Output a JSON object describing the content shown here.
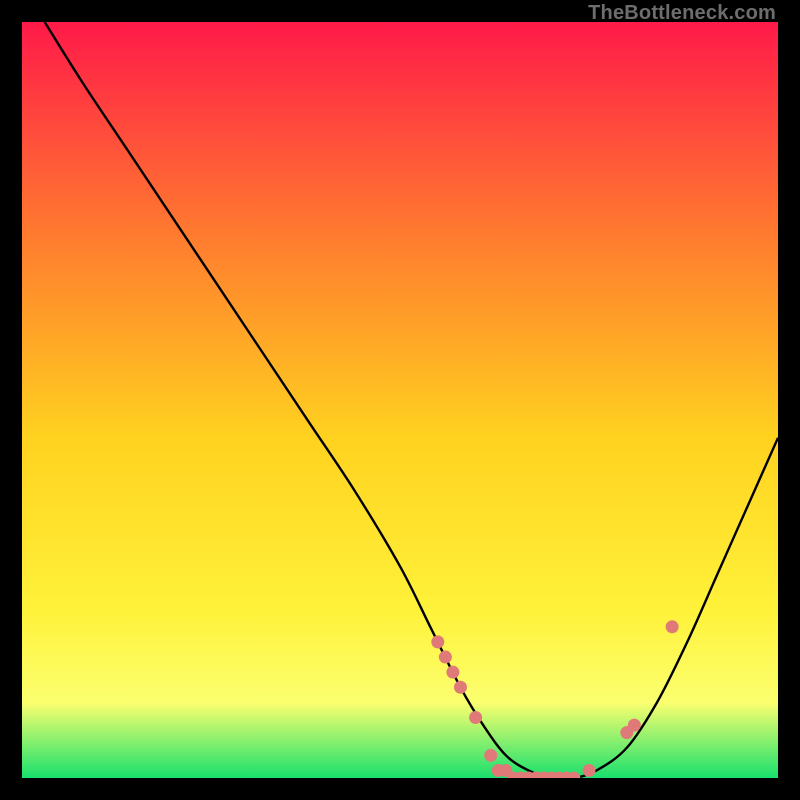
{
  "attribution": "TheBottleneck.com",
  "colors": {
    "gradient_top": "#ff1a49",
    "gradient_mid1": "#ff7a2f",
    "gradient_mid2": "#ffd21f",
    "gradient_mid3": "#fff23a",
    "gradient_bottom_yellow": "#fbff6f",
    "gradient_green": "#18e06d",
    "curve": "#000000",
    "dot": "#e07a78"
  },
  "chart_data": {
    "type": "line",
    "title": "",
    "xlabel": "",
    "ylabel": "",
    "xlim": [
      0,
      100
    ],
    "ylim": [
      0,
      100
    ],
    "series": [
      {
        "name": "bottleneck-curve",
        "x": [
          3,
          8,
          14,
          20,
          26,
          32,
          38,
          44,
          50,
          54,
          58,
          61,
          64,
          67,
          70,
          73,
          76,
          80,
          84,
          88,
          92,
          96,
          100
        ],
        "y": [
          100,
          92,
          83,
          74,
          65,
          56,
          47,
          38,
          28,
          20,
          12,
          7,
          3,
          1,
          0,
          0,
          1,
          4,
          10,
          18,
          27,
          36,
          45
        ]
      }
    ],
    "points": [
      {
        "name": "dots",
        "x": [
          55,
          56,
          57,
          58,
          60,
          62,
          63,
          64,
          65,
          66,
          67,
          68,
          69,
          70,
          71,
          72,
          73,
          75,
          80,
          81,
          86
        ],
        "y": [
          18,
          16,
          14,
          12,
          8,
          3,
          1,
          1,
          0,
          0,
          0,
          0,
          0,
          0,
          0,
          0,
          0,
          1,
          6,
          7,
          20
        ]
      }
    ],
    "annotations": []
  }
}
